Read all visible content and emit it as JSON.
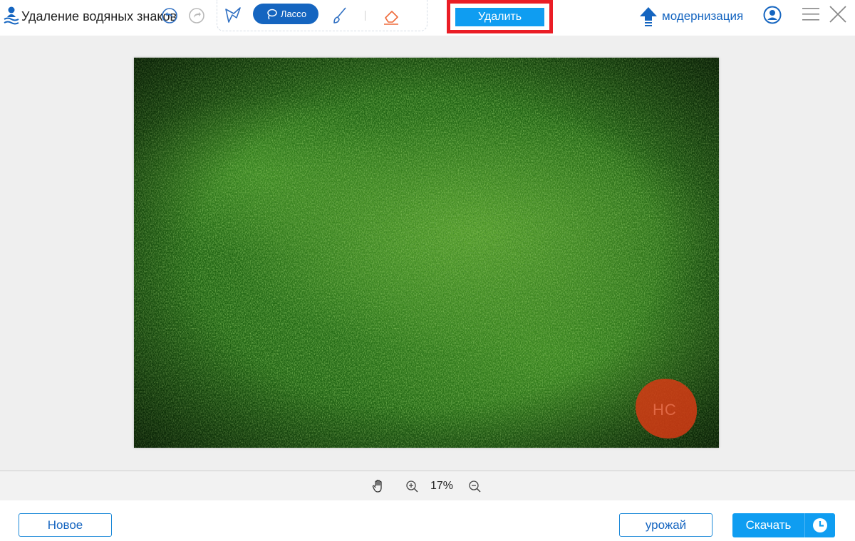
{
  "app": {
    "title": "Удаление водяных знаков",
    "logo_icon": "watermark-remover-logo-icon"
  },
  "toolbar": {
    "undo_icon": "undo-icon",
    "redo_icon": "redo-icon",
    "tools": [
      {
        "id": "polygon",
        "icon": "polygon-select-icon"
      },
      {
        "id": "lasso",
        "label": "Лассо",
        "icon": "lasso-icon",
        "active": true
      },
      {
        "id": "brush",
        "icon": "brush-icon"
      },
      {
        "id": "eraser",
        "icon": "eraser-icon"
      }
    ],
    "delete_label": "Удалить"
  },
  "header_right": {
    "upgrade_label": "модернизация",
    "upgrade_icon": "upgrade-arrow-icon",
    "account_icon": "account-icon",
    "menu_icon": "menu-icon",
    "close_icon": "close-icon"
  },
  "canvas": {
    "image_description_icon": "grass-photo",
    "watermark_text": "HC"
  },
  "zoombar": {
    "hand_icon": "hand-icon",
    "zoom_in_icon": "zoom-in-icon",
    "zoom_value": "17%",
    "zoom_out_icon": "zoom-out-icon"
  },
  "footer": {
    "new_label": "Новое",
    "crop_label": "урожай",
    "download_label": "Скачать",
    "history_icon": "clock-icon"
  },
  "colors": {
    "primary": "#1565c0",
    "accent": "#0f9df1",
    "highlight": "#ea1d25",
    "lasso_mask": "#d63a14"
  }
}
